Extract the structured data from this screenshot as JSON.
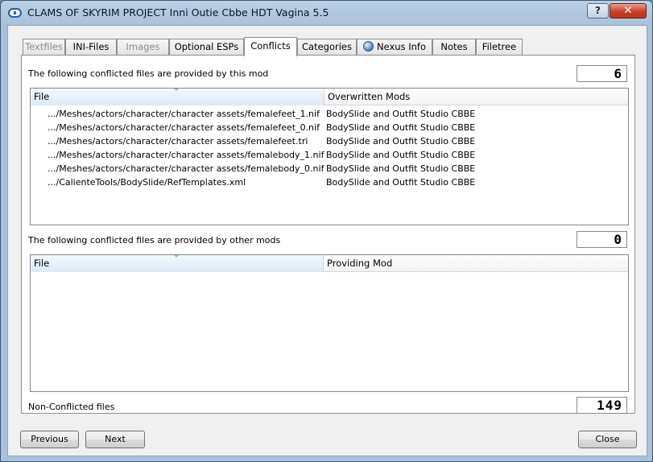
{
  "window": {
    "title": "CLAMS OF SKYRIM PROJECT Inni Outie Cbbe HDT Vagina 5.5",
    "help_label": "?",
    "close_label": "✕"
  },
  "tabs": [
    {
      "label": "Textfiles",
      "state": "disabled"
    },
    {
      "label": "INI-Files",
      "state": "normal"
    },
    {
      "label": "Images",
      "state": "disabled"
    },
    {
      "label": "Optional ESPs",
      "state": "normal"
    },
    {
      "label": "Conflicts",
      "state": "active"
    },
    {
      "label": "Categories",
      "state": "normal"
    },
    {
      "label": "Nexus Info",
      "state": "normal",
      "icon": "globe-icon"
    },
    {
      "label": "Notes",
      "state": "normal"
    },
    {
      "label": "Filetree",
      "state": "normal"
    }
  ],
  "conflicts": {
    "provided_by_this": {
      "label": "The following conflicted files are provided by this mod",
      "count": "6",
      "columns": [
        "File",
        "Overwritten Mods"
      ],
      "rows": [
        {
          "file": ".../Meshes/actors/character/character assets/femalefeet_1.nif",
          "mod": "BodySlide and Outfit Studio CBBE"
        },
        {
          "file": ".../Meshes/actors/character/character assets/femalefeet_0.nif",
          "mod": "BodySlide and Outfit Studio CBBE"
        },
        {
          "file": ".../Meshes/actors/character/character assets/femalefeet.tri",
          "mod": "BodySlide and Outfit Studio CBBE"
        },
        {
          "file": ".../Meshes/actors/character/character assets/femalebody_1.nif",
          "mod": "BodySlide and Outfit Studio CBBE"
        },
        {
          "file": ".../Meshes/actors/character/character assets/femalebody_0.nif",
          "mod": "BodySlide and Outfit Studio CBBE"
        },
        {
          "file": ".../CalienteTools/BodySlide/RefTemplates.xml",
          "mod": "BodySlide and Outfit Studio CBBE"
        }
      ]
    },
    "provided_by_other": {
      "label": "The following conflicted files are provided by other mods",
      "count": "0",
      "columns": [
        "File",
        "Providing Mod"
      ],
      "rows": []
    },
    "non_conflicted": {
      "label": "Non-Conflicted files",
      "count": "149"
    }
  },
  "buttons": {
    "previous": "Previous",
    "next": "Next",
    "close": "Close"
  },
  "colors": {
    "title_bar": "#a9c1db",
    "close_button": "#c9412a"
  }
}
